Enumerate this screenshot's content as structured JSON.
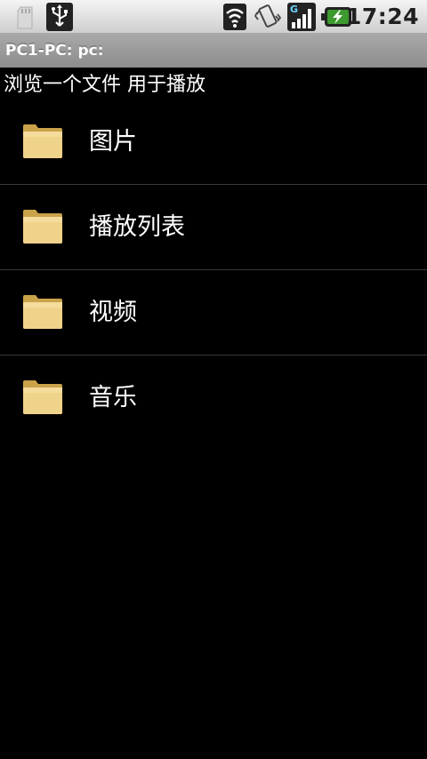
{
  "status_bar": {
    "icons": [
      "sd-card-icon",
      "usb-icon",
      "wifi-icon",
      "vibrate-icon",
      "signal-icon",
      "battery-charging-icon"
    ],
    "network_type": "G",
    "time": "17:24"
  },
  "title_bar": {
    "title": "PC1-PC: pc:"
  },
  "header": {
    "text": "浏览一个文件 用于播放"
  },
  "folders": [
    {
      "label": "图片",
      "icon": "folder-icon"
    },
    {
      "label": "播放列表",
      "icon": "folder-icon"
    },
    {
      "label": "视频",
      "icon": "folder-icon"
    },
    {
      "label": "音乐",
      "icon": "folder-icon"
    }
  ],
  "colors": {
    "background": "#000000",
    "folder": "#e6c77a",
    "title_bar": "#9b9b9b",
    "status_bar": "#e4e4e4"
  }
}
